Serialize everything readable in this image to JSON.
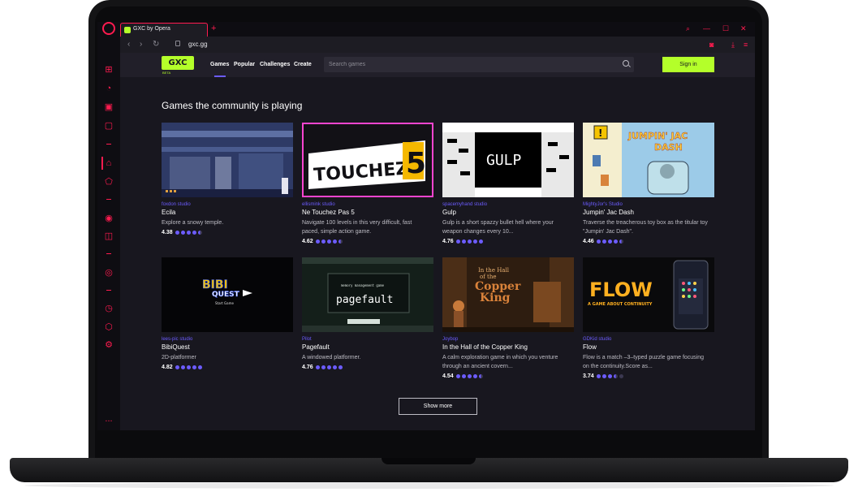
{
  "browser": {
    "tab_title": "GXC by Opera",
    "new_tab": "+",
    "url": "gxc.gg",
    "back": "‹",
    "forward": "›",
    "reload": "↻",
    "window_controls": [
      "⌕",
      "—",
      "☐",
      "✕"
    ],
    "sidebar_icons": [
      "gamepad-icon",
      "speedometer-icon",
      "gift-icon",
      "twitch-icon",
      "home-icon",
      "pentagon-icon",
      "messenger-icon",
      "instagram-icon",
      "player-icon",
      "clock-icon",
      "cube-icon",
      "settings-icon",
      "more-icon"
    ],
    "more_label": "..."
  },
  "site": {
    "logo_text": "GXC",
    "beta_label": "BETA",
    "nav": [
      "Games",
      "Popular",
      "Challenges",
      "Create"
    ],
    "search_placeholder": "Search games",
    "signin_label": "Sign in",
    "accent": "#b4ff2a",
    "link_color": "#6c5cff"
  },
  "main": {
    "section_title": "Games the community is playing",
    "show_more_label": "Show more",
    "games": [
      {
        "studio": "foxdon studio",
        "name": "Ecila",
        "desc": "Explore a snowy temple.",
        "rating": "4.38",
        "stars": [
          "full",
          "full",
          "full",
          "full",
          "half"
        ]
      },
      {
        "studio": "ellismink studio",
        "name": "Ne Touchez Pas 5",
        "desc": "Navigate 100 levels in this very difficult, fast paced, simple action game.",
        "rating": "4.62",
        "stars": [
          "full",
          "full",
          "full",
          "full",
          "half"
        ],
        "thumb_text": "TOUCHEZ"
      },
      {
        "studio": "spacemyhand studio",
        "name": "Gulp",
        "desc": "Gulp is a short spazzy bullet hell where your weapon changes every 10...",
        "rating": "4.76",
        "stars": [
          "full",
          "full",
          "full",
          "full",
          "full"
        ],
        "thumb_text": "GULP"
      },
      {
        "studio": "MightyJor's Studio",
        "name": "Jumpin' Jac Dash",
        "desc": "Traverse the treacherous toy box as the titular toy \"Jumpin' Jac Dash\".",
        "rating": "4.46",
        "stars": [
          "full",
          "full",
          "full",
          "full",
          "half"
        ],
        "thumb_text": "JUMPIN' JAC DASH"
      },
      {
        "studio": "lees-pic studio",
        "name": "BibiQuest",
        "desc": "2D-platformer",
        "rating": "4.82",
        "stars": [
          "full",
          "full",
          "full",
          "full",
          "full"
        ],
        "thumb_text": "BIBI QUEST",
        "thumb_sub": "Start Game"
      },
      {
        "studio": "Pilot",
        "name": "Pagefault",
        "desc": "A windowed platformer.",
        "rating": "4.76",
        "stars": [
          "full",
          "full",
          "full",
          "full",
          "full"
        ],
        "thumb_text": "pagefault",
        "thumb_sub": "memory management game"
      },
      {
        "studio": "Joybop",
        "name": "In the Hall of the Copper King",
        "desc": "A calm exploration game in which you venture through an ancient covern...",
        "rating": "4.54",
        "stars": [
          "full",
          "full",
          "full",
          "full",
          "half"
        ],
        "thumb_text": "In the Hall of the Copper King"
      },
      {
        "studio": "GDKid studio",
        "name": "Flow",
        "desc": "Flow is a match –3–typed puzzle game focusing on the continuity.Score as...",
        "rating": "3.74",
        "stars": [
          "full",
          "full",
          "full",
          "half",
          "empty"
        ],
        "thumb_text": "FLOW",
        "thumb_sub": "A GAME ABOUT CONTINUITY"
      }
    ]
  }
}
